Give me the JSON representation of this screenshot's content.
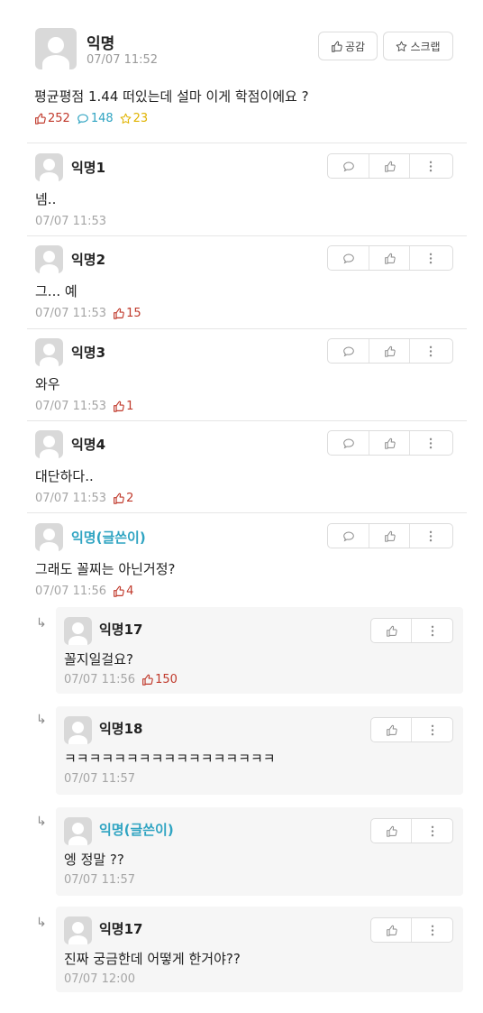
{
  "post": {
    "author": "익명",
    "time": "07/07 11:52",
    "like_button": "공감",
    "scrap_button": "스크랩",
    "title": "평균평점 1.44 떠있는데 설마 이게 학점이에요 ?",
    "likes": "252",
    "comments": "148",
    "scraps": "23"
  },
  "comments": [
    {
      "author": "익명1",
      "text": "넴..",
      "time": "07/07 11:53",
      "votes": ""
    },
    {
      "author": "익명2",
      "text": "그... 예",
      "time": "07/07 11:53",
      "votes": "15"
    },
    {
      "author": "익명3",
      "text": "와우",
      "time": "07/07 11:53",
      "votes": "1"
    },
    {
      "author": "익명4",
      "text": "대단하다..",
      "time": "07/07 11:53",
      "votes": "2"
    },
    {
      "author": "익명(글쓴이)",
      "text": "그래도 꼴찌는 아닌거정?",
      "time": "07/07 11:56",
      "votes": "4"
    }
  ],
  "replies": [
    {
      "author": "익명17",
      "text": "꼴지일걸요?",
      "time": "07/07 11:56",
      "votes": "150"
    },
    {
      "author": "익명18",
      "text": "ㅋㅋㅋㅋㅋㅋㅋㅋㅋㅋㅋㅋㅋㅋㅋㅋㅋ",
      "time": "07/07 11:57",
      "votes": ""
    },
    {
      "author": "익명(글쓴이)",
      "text": "엥 정말 ??",
      "time": "07/07 11:57",
      "votes": ""
    },
    {
      "author": "익명17",
      "text": "진짜 궁금한데 어떻게 한거야??",
      "time": "07/07 12:00",
      "votes": ""
    }
  ],
  "colors": {
    "vote_red": "#c0392b",
    "comment_blue": "#2fa4c2",
    "scrap_yellow": "#e0b300",
    "op_author": "#2fa4c2"
  },
  "icons": {
    "like": "thumbs-up-icon",
    "comment": "speech-bubble-icon",
    "scrap": "star-icon",
    "more": "more-vertical-icon",
    "reply": "reply-arrow-icon"
  }
}
